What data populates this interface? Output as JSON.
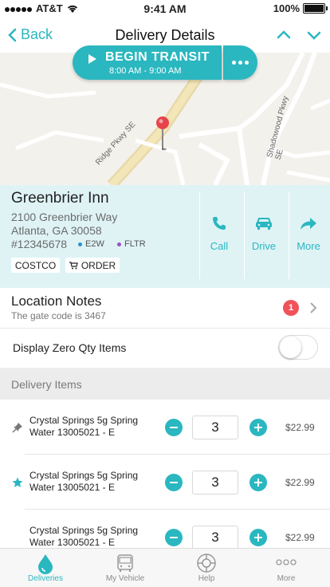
{
  "status_bar": {
    "carrier": "AT&T",
    "time": "9:41 AM",
    "battery": "100%"
  },
  "nav": {
    "back_label": "Back",
    "title": "Delivery Details"
  },
  "transit": {
    "label": "BEGIN TRANSIT",
    "window": "8:00 AM - 9:00 AM"
  },
  "map": {
    "roads": [
      "Ridge Pkwy SE",
      "Shadowood Pkwy SE"
    ]
  },
  "stop": {
    "name": "Greenbrier Inn",
    "address_line1": "2100 Greenbrier Way",
    "address_line2": "Atlanta, GA 30058",
    "number": "#12345678",
    "tags": [
      {
        "label": "E2W",
        "color": "#2b8fd6"
      },
      {
        "label": "FLTR",
        "color": "#9b4fc9"
      }
    ],
    "chips": [
      "COSTCO",
      "ORDER"
    ],
    "actions": [
      {
        "label": "Call",
        "icon": "phone-icon"
      },
      {
        "label": "Drive",
        "icon": "car-icon"
      },
      {
        "label": "More",
        "icon": "share-arrow-icon"
      }
    ]
  },
  "notes": {
    "title": "Location Notes",
    "subtitle": "The gate code is 3467",
    "badge": "1"
  },
  "zero_qty": {
    "label": "Display Zero Qty Items",
    "enabled": false
  },
  "delivery_items": {
    "header": "Delivery Items",
    "items": [
      {
        "name": "Crystal Springs 5g Spring Water 13005021 - E",
        "qty": "3",
        "price": "$22.99",
        "icon": "pin-icon"
      },
      {
        "name": "Crystal Springs 5g Spring Water 13005021 - E",
        "qty": "3",
        "price": "$22.99",
        "icon": "star-icon"
      },
      {
        "name": "Crystal Springs 5g Spring Water 13005021 - E",
        "qty": "3",
        "price": "$22.99",
        "icon": "none"
      }
    ]
  },
  "tabs": [
    {
      "label": "Deliveries",
      "icon": "drop-icon",
      "active": true
    },
    {
      "label": "My Vehicle",
      "icon": "bus-icon",
      "active": false
    },
    {
      "label": "Help",
      "icon": "lifebuoy-icon",
      "active": false
    },
    {
      "label": "More",
      "icon": "dots-icon",
      "active": false
    }
  ],
  "colors": {
    "accent": "#2ab7c0",
    "card_bg": "#dff3f5",
    "badge": "#f0525a"
  }
}
